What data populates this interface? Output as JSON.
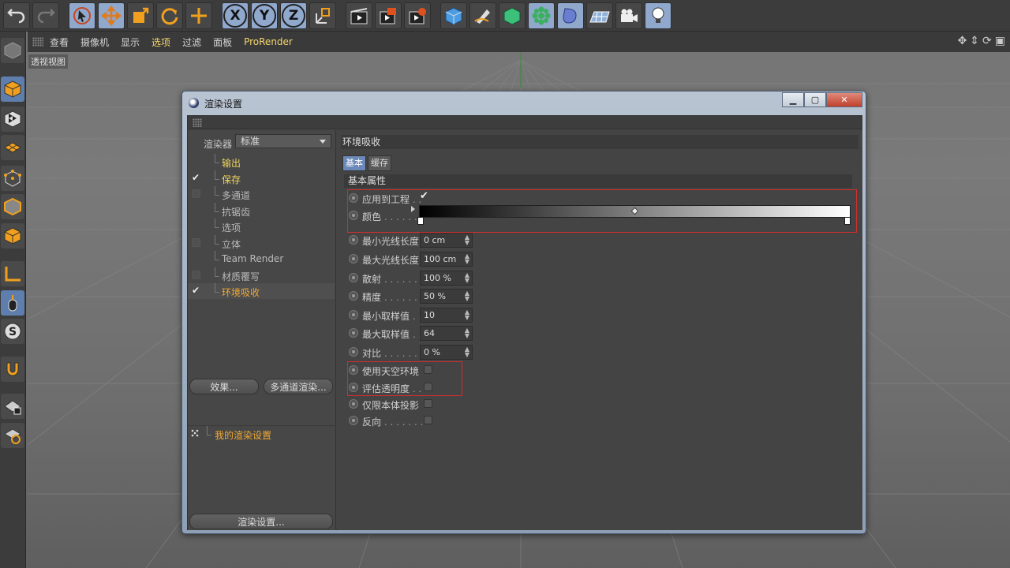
{
  "menu": {
    "items": [
      "查看",
      "摄像机",
      "显示",
      "选项",
      "过滤",
      "面板",
      "ProRender"
    ]
  },
  "viewport": {
    "label": "透视视图"
  },
  "toolbar": {
    "icons": [
      "undo-icon",
      "redo-icon",
      "select-icon",
      "move-icon",
      "scale-icon",
      "rotate-icon",
      "add-icon",
      "axis-x-icon",
      "axis-y-icon",
      "axis-z-icon",
      "coordinate-system-icon",
      "render-view-icon",
      "render-picture-viewer-icon",
      "render-settings-icon",
      "cube-icon",
      "pen-icon",
      "subdivision-icon",
      "mograph-icon",
      "deformer-icon",
      "floor-icon",
      "camera-icon",
      "light-icon"
    ],
    "axis": [
      "X",
      "Y",
      "Z"
    ]
  },
  "dialog": {
    "title": "渲染设置",
    "renderer_label": "渲染器",
    "renderer_value": "标准",
    "tree": [
      {
        "label": "输出",
        "checked": null,
        "color": "yellow"
      },
      {
        "label": "保存",
        "checked": true,
        "color": "yellow"
      },
      {
        "label": "多通道",
        "checked": false,
        "color": "normal"
      },
      {
        "label": "抗锯齿",
        "checked": null,
        "color": "normal"
      },
      {
        "label": "选项",
        "checked": null,
        "color": "normal"
      },
      {
        "label": "立体",
        "checked": false,
        "color": "normal"
      },
      {
        "label": "Team Render",
        "checked": null,
        "color": "normal"
      },
      {
        "label": "材质覆写",
        "checked": false,
        "color": "normal"
      },
      {
        "label": "环境吸收",
        "checked": true,
        "color": "orange"
      }
    ],
    "effects_button": "效果...",
    "multipass_button": "多通道渲染...",
    "my_settings": "我的渲染设置",
    "render_settings_button": "渲染设置...",
    "section_title": "环境吸收",
    "tabs": [
      "基本",
      "缓存"
    ],
    "group_title": "基本属性",
    "props": {
      "apply_to_project": {
        "label": "应用到工程",
        "dots": " . .",
        "checked": true
      },
      "color": {
        "label": "颜色",
        "dots": " . . . . . ."
      },
      "min_ray_length": {
        "label": "最小光线长度",
        "value": "0 cm"
      },
      "max_ray_length": {
        "label": "最大光线长度",
        "value": "100 cm"
      },
      "dispersion": {
        "label": "散射",
        "dots": " . . . . . . .",
        "value": "100 %"
      },
      "accuracy": {
        "label": "精度",
        "dots": " . . . . . . .",
        "value": "50 %"
      },
      "min_samples": {
        "label": "最小取样值",
        "dots": " . .",
        "value": "10"
      },
      "max_samples": {
        "label": "最大取样值",
        "dots": " . .",
        "value": "64"
      },
      "contrast": {
        "label": "对比",
        "dots": " . . . . . . .",
        "value": "0 %"
      },
      "use_sky": {
        "label": "使用天空环境",
        "checked": false
      },
      "eval_transparency": {
        "label": "评估透明度",
        "dots": " . .",
        "checked": false
      },
      "self_shadow_only": {
        "label": "仅限本体投影",
        "checked": false
      },
      "invert": {
        "label": "反向",
        "dots": " . . . . . . .",
        "checked": false
      }
    }
  },
  "colors": {
    "highlight": "#d02e2e",
    "accent_yellow": "#f2d65f",
    "accent_orange": "#f0a832",
    "tab_active": "#6b89b8"
  }
}
